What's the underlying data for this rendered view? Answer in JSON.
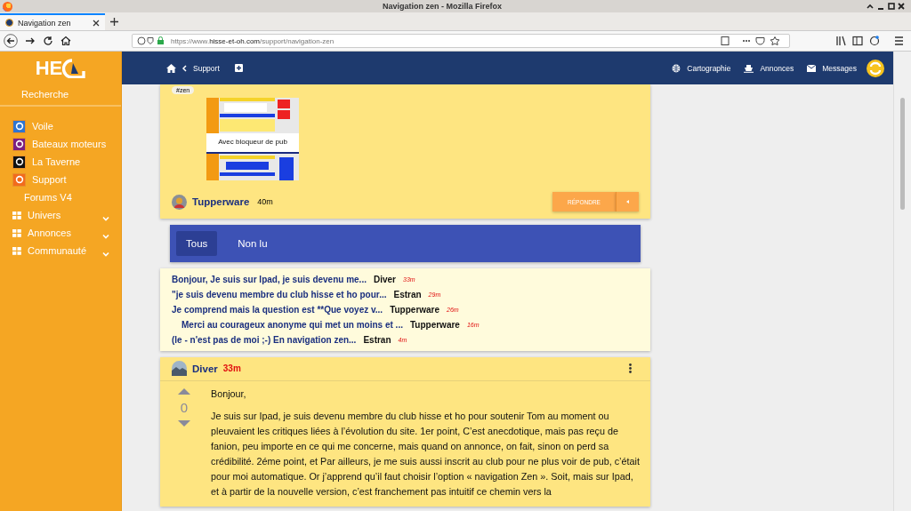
{
  "browser": {
    "window_title": "Navigation zen - Mozilla Firefox",
    "tab_title": "Navigation zen",
    "url_prefix": "https://www.",
    "url_host": "hisse-et-oh.com",
    "url_path": "/support/navigation-zen"
  },
  "sidebar": {
    "logo": "HE",
    "search": "Recherche",
    "items": [
      {
        "label": "Voile",
        "kind": "forum",
        "color": "#2f74d0"
      },
      {
        "label": "Bateaux moteurs",
        "kind": "forum",
        "color": "#7b1f80"
      },
      {
        "label": "La Taverne",
        "kind": "forum",
        "color": "#111111"
      },
      {
        "label": "Support",
        "kind": "forum",
        "color": "#f26b1d"
      },
      {
        "label": "Forums V4",
        "kind": "link"
      },
      {
        "label": "Univers",
        "kind": "group",
        "expanded": false
      },
      {
        "label": "Annonces",
        "kind": "group",
        "expanded": false
      },
      {
        "label": "Communauté",
        "kind": "group",
        "expanded": false
      }
    ]
  },
  "header": {
    "breadcrumb": "Support",
    "links": [
      "Cartographie",
      "Annonces",
      "Messages"
    ]
  },
  "post": {
    "tag": "#zen",
    "image_caption": "Avec bloqueur de pub",
    "author": "Tupperware",
    "time": "40m",
    "reply": "RÉPONDRE"
  },
  "filter_tabs": [
    {
      "label": "Tous",
      "selected": true
    },
    {
      "label": "Non lu",
      "selected": false
    }
  ],
  "threads": [
    {
      "excerpt": "Bonjour, Je suis sur Ipad, je suis devenu me...",
      "author": "Diver",
      "time": "33m"
    },
    {
      "excerpt": "\"je suis devenu membre du club hisse et ho pour...",
      "author": "Estran",
      "time": "29m"
    },
    {
      "excerpt": "Je comprend mais la question est **Que voyez v...",
      "author": "Tupperware",
      "time": "26m",
      "children": [
        {
          "excerpt": "Merci au courageux anonyme qui met un moins et ...",
          "author": "Tupperware",
          "time": "16m"
        }
      ]
    },
    {
      "excerpt": "(le - n'est pas de moi ;-) En navigation zen...",
      "author": "Estran",
      "time": "4m"
    }
  ],
  "comment": {
    "author": "Diver",
    "time": "33m",
    "votes": "0",
    "paragraphs": [
      "Bonjour,",
      "Je suis sur Ipad, je suis devenu membre du club hisse et ho pour soutenir Tom au moment ou pleuvaient les critiques liées à l’évolution du site. 1er point, C’est anecdotique, mais pas reçu de fanion, peu importe en ce qui me concerne, mais quand on annonce, on fait, sinon on perd sa crédibilité. 2éme point, et Par ailleurs, je me suis aussi inscrit au club pour ne plus voir de pub, c’était pour moi automatique. Or j’apprend qu’il faut choisir l’option « navigation Zen ». Soit, mais sur Ipad, et à partir de la nouvelle version, c’est franchement pas intuitif ce chemin vers la"
    ]
  }
}
